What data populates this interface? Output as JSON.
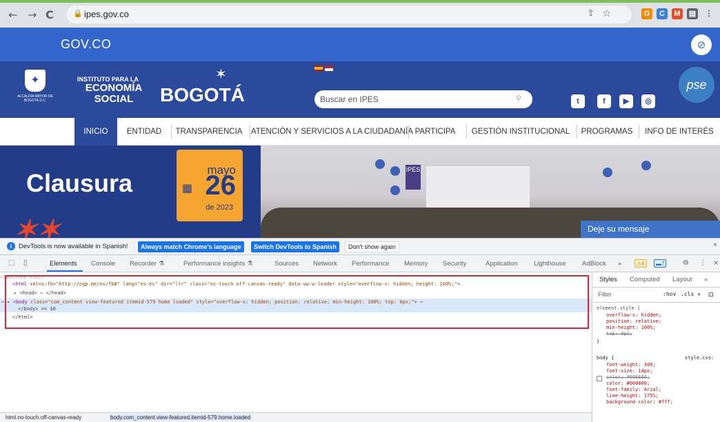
{
  "browser": {
    "url": "ipes.gov.co",
    "nav_back": "←",
    "nav_forward": "→",
    "nav_reload": "C"
  },
  "govco": {
    "logo_text": "GOV.CO"
  },
  "site_header": {
    "alcaldia_text": "ALCALDÍA MAYOR DE BOGOTÁ D.C.",
    "institute_line1": "INSTITUTO PARA LA",
    "institute_line2": "ECONOMÍA SOCIAL",
    "bogota_text": "BOGOTÁ",
    "search_placeholder": "Buscar en IPES",
    "pse_text": "pse"
  },
  "main_nav": {
    "items": [
      "INICIO",
      "ENTIDAD",
      "TRANSPARENCIA",
      "ATENCIÓN Y SERVICIOS A LA CIUDADANÍA",
      "PARTICIPA",
      "GESTIÓN INSTITUCIONAL",
      "PROGRAMAS",
      "INFO DE INTERÉS"
    ]
  },
  "banner": {
    "title": "Clausura",
    "month": "mayo",
    "day": "26",
    "year_text": "de 2023",
    "projection_text": "IPES",
    "chat_label": "Deje su mensaje"
  },
  "devtools": {
    "infobar": {
      "message": "DevTools is now available in Spanish!",
      "btn_match": "Always match Chrome's language",
      "btn_switch": "Switch DevTools to Spanish",
      "btn_dismiss": "Don't show again"
    },
    "tabs": [
      "Elements",
      "Console",
      "Recorder ⚗",
      "Performance insights ⚗",
      "Sources",
      "Network",
      "Performance",
      "Memory",
      "Security",
      "Application",
      "Lighthouse",
      "AdBlock",
      "»"
    ],
    "warnings_count": "6",
    "messages_count": "7",
    "dom_lines": {
      "doctype": "<!DOCTYPE html>",
      "html_line": {
        "open": "<html",
        "attrs": " xmlns:fb=\"http://ogp.me/ns/fb#\" lang=\"es-es\" dir=\"ltr\" class=\"no-touch off-canvas-ready\" data-uw-w-loader style=\"overflow-x: hidden; height: 100%;\"",
        "close": ">"
      },
      "head_line": "▸ <head> ⋯ </head>",
      "body_line": {
        "prefix": "⋯ ▸ ",
        "open": "<body",
        "attrs": " class=\"com_content view-featured itemid-579 home loaded\" style=\"overflow-x: hidden; position: relative; min-height: 100%; top: 0px;\"",
        "close": "> ⋯"
      },
      "body_close": "</body> == $0",
      "html_close": "</html>"
    },
    "styles": {
      "tabs": [
        "Styles",
        "Computed",
        "Layout",
        "»"
      ],
      "filter_placeholder": "Filter",
      "filter_hov": ":hov",
      "filter_cls": ".cls",
      "element_style_selector": "element.style {",
      "element_style_props": [
        "overflow-x: hidden;",
        "position: relative;",
        "min-height: 100%;",
        "top: 0px;"
      ],
      "close_brace": "}",
      "body_selector": "body {",
      "body_source": "style.css:",
      "body_props": [
        "font-weight: 300;",
        "font-size: 14px;",
        "color: #666666;",
        "color: #000000;",
        "font-family: Arial;",
        "line-height: 175%;",
        "background-color: #fff;"
      ]
    },
    "status_bar": {
      "crumb_html": "html.no-touch.off-canvas-ready",
      "crumb_body": "body.com_content.view-featured.itemid-579.home.loaded"
    }
  },
  "colors": {
    "govco_blue": "#3366cc",
    "header_blue": "#2c4a9b",
    "banner_orange": "#f6a531",
    "devtools_blue": "#1a73e8",
    "highlight_red": "#e0232e"
  }
}
